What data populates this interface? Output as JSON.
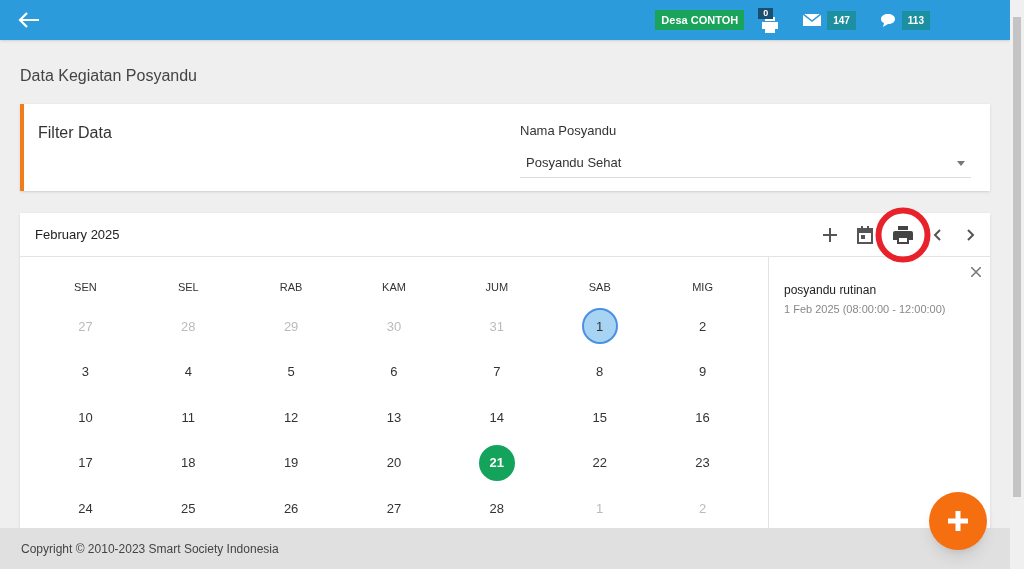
{
  "topbar": {
    "village_badge": "Desa CONTOH",
    "notifications": [
      {
        "kind": "printer",
        "count": "0"
      },
      {
        "kind": "mail",
        "count": "147"
      },
      {
        "kind": "chat",
        "count": "113"
      }
    ]
  },
  "page_title": "Data Kegiatan Posyandu",
  "filter": {
    "title": "Filter Data",
    "field_label": "Nama Posyandu",
    "value": "Posyandu Sehat"
  },
  "calendar": {
    "month": "February 2025",
    "weekdays": [
      "SEN",
      "SEL",
      "RAB",
      "KAM",
      "JUM",
      "SAB",
      "MIG"
    ],
    "weeks": [
      [
        {
          "d": "27",
          "outside": true,
          "selected": false,
          "today": false
        },
        {
          "d": "28",
          "outside": true,
          "selected": false,
          "today": false
        },
        {
          "d": "29",
          "outside": true,
          "selected": false,
          "today": false
        },
        {
          "d": "30",
          "outside": true,
          "selected": false,
          "today": false
        },
        {
          "d": "31",
          "outside": true,
          "selected": false,
          "today": false
        },
        {
          "d": "1",
          "outside": false,
          "selected": true,
          "today": false
        },
        {
          "d": "2",
          "outside": false,
          "selected": false,
          "today": false
        }
      ],
      [
        {
          "d": "3",
          "outside": false,
          "selected": false,
          "today": false
        },
        {
          "d": "4",
          "outside": false,
          "selected": false,
          "today": false
        },
        {
          "d": "5",
          "outside": false,
          "selected": false,
          "today": false
        },
        {
          "d": "6",
          "outside": false,
          "selected": false,
          "today": false
        },
        {
          "d": "7",
          "outside": false,
          "selected": false,
          "today": false
        },
        {
          "d": "8",
          "outside": false,
          "selected": false,
          "today": false
        },
        {
          "d": "9",
          "outside": false,
          "selected": false,
          "today": false
        }
      ],
      [
        {
          "d": "10",
          "outside": false,
          "selected": false,
          "today": false
        },
        {
          "d": "11",
          "outside": false,
          "selected": false,
          "today": false
        },
        {
          "d": "12",
          "outside": false,
          "selected": false,
          "today": false
        },
        {
          "d": "13",
          "outside": false,
          "selected": false,
          "today": false
        },
        {
          "d": "14",
          "outside": false,
          "selected": false,
          "today": false
        },
        {
          "d": "15",
          "outside": false,
          "selected": false,
          "today": false
        },
        {
          "d": "16",
          "outside": false,
          "selected": false,
          "today": false
        }
      ],
      [
        {
          "d": "17",
          "outside": false,
          "selected": false,
          "today": false
        },
        {
          "d": "18",
          "outside": false,
          "selected": false,
          "today": false
        },
        {
          "d": "19",
          "outside": false,
          "selected": false,
          "today": false
        },
        {
          "d": "20",
          "outside": false,
          "selected": false,
          "today": false
        },
        {
          "d": "21",
          "outside": false,
          "selected": false,
          "today": true
        },
        {
          "d": "22",
          "outside": false,
          "selected": false,
          "today": false
        },
        {
          "d": "23",
          "outside": false,
          "selected": false,
          "today": false
        }
      ],
      [
        {
          "d": "24",
          "outside": false,
          "selected": false,
          "today": false
        },
        {
          "d": "25",
          "outside": false,
          "selected": false,
          "today": false
        },
        {
          "d": "26",
          "outside": false,
          "selected": false,
          "today": false
        },
        {
          "d": "27",
          "outside": false,
          "selected": false,
          "today": false
        },
        {
          "d": "28",
          "outside": false,
          "selected": false,
          "today": false
        },
        {
          "d": "1",
          "outside": true,
          "selected": false,
          "today": false
        },
        {
          "d": "2",
          "outside": true,
          "selected": false,
          "today": false
        }
      ]
    ],
    "event": {
      "title": "posyandu rutinan",
      "time": "1 Feb 2025 (08:00:00 - 12:00:00)"
    }
  },
  "footer": "Copyright © 2010-2023 Smart Society Indonesia"
}
